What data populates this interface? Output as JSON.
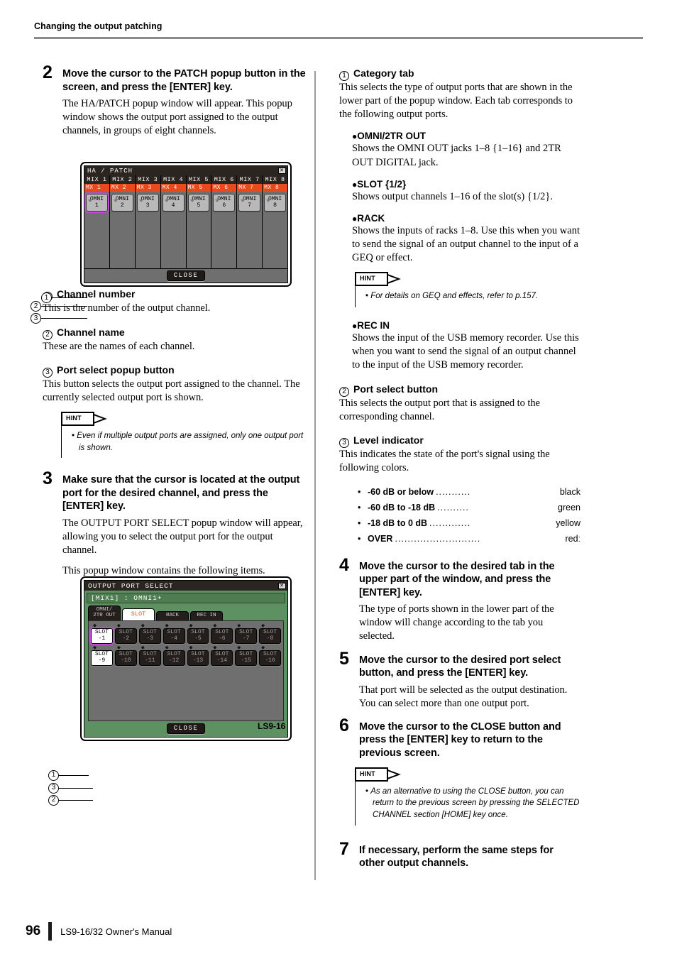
{
  "header": {
    "title": "Changing the output patching"
  },
  "footer": {
    "page_number": "96",
    "manual": "LS9-16/32  Owner's Manual"
  },
  "left": {
    "step2": {
      "num": "2",
      "head": "Move the cursor to the PATCH popup button in the screen, and press the [ENTER] key.",
      "body": "The HA/PATCH popup window will appear. This popup window shows the output port assigned to the output channels, in groups of eight channels."
    },
    "ha_patch": {
      "title": "HA / PATCH",
      "close_icon": "close-icon",
      "close_label": "CLOSE",
      "channel_numbers": [
        "MIX 1",
        "MIX 2",
        "MIX 3",
        "MIX 4",
        "MIX 5",
        "MIX 6",
        "MIX 7",
        "MIX 8"
      ],
      "channel_names": [
        "MX  1",
        "MX  2",
        "MX  3",
        "MX  4",
        "MX  5",
        "MX  6",
        "MX  7",
        "MX  8"
      ],
      "port_buttons": [
        "OMNI\n1",
        "OMNI\n2",
        "OMNI\n3",
        "OMNI\n4",
        "OMNI\n5",
        "OMNI\n6",
        "OMNI\n7",
        "OMNI\n8"
      ],
      "port_top": "OMNI",
      "port_nums": [
        "1",
        "2",
        "3",
        "4",
        "5",
        "6",
        "7",
        "8"
      ],
      "selected_index": 0,
      "callouts": [
        "1",
        "2",
        "3"
      ],
      "accent_name_row": "#e8491d",
      "cursor_color": "#c14bd6"
    },
    "items": [
      {
        "num": "1",
        "head": "Channel number",
        "body": "This is the number of the output channel."
      },
      {
        "num": "2",
        "head": "Channel name",
        "body": "These are the names of each channel."
      },
      {
        "num": "3",
        "head": "Port select popup button",
        "body": "This button selects the output port assigned to the channel. The currently selected output port is shown."
      }
    ],
    "hint1": {
      "tag": "HINT",
      "text": "Even if multiple output ports are assigned, only one output port is shown."
    },
    "step3": {
      "num": "3",
      "head": "Make sure that the cursor is located at the output port for the desired channel, and press the [ENTER] key.",
      "body": "The OUTPUT PORT SELECT popup window will appear, allowing you to select the output port for the output channel.",
      "body2": "This popup window contains the following items."
    },
    "ops": {
      "title": "OUTPUT PORT SELECT",
      "close_icon": "close-icon",
      "subtitle": "[MIX1] : OMNI1+",
      "tabs": [
        {
          "label": "OMNI/\n2TR OUT",
          "line1": "OMNI/",
          "line2": "2TR OUT",
          "active": false
        },
        {
          "label": "SLOT",
          "line1": "SLOT",
          "line2": "",
          "active": true
        },
        {
          "label": "RACK",
          "line1": "RACK",
          "line2": "",
          "active": false
        },
        {
          "label": "REC IN",
          "line1": "REC IN",
          "line2": "",
          "active": false
        }
      ],
      "row1": [
        "SLOT\n-1",
        "SLOT\n-2",
        "SLOT\n-3",
        "SLOT\n-4",
        "SLOT\n-5",
        "SLOT\n-6",
        "SLOT\n-7",
        "SLOT\n-8"
      ],
      "row1_top": [
        "SLOT",
        "SLOT",
        "SLOT",
        "SLOT",
        "SLOT",
        "SLOT",
        "SLOT",
        "SLOT"
      ],
      "row1_bot": [
        "-1",
        "-2",
        "-3",
        "-4",
        "-5",
        "-6",
        "-7",
        "-8"
      ],
      "row2_top": [
        "SLOT",
        "SLOT",
        "SLOT",
        "SLOT",
        "SLOT",
        "SLOT",
        "SLOT",
        "SLOT"
      ],
      "row2_bot": [
        "-9",
        "-10",
        "-11",
        "-12",
        "-13",
        "-14",
        "-15",
        "-16"
      ],
      "selected": [
        "-1",
        "-9"
      ],
      "cursor_on": "-1",
      "close_label": "CLOSE",
      "callouts": [
        "1",
        "3",
        "2"
      ],
      "caption": "LS9-16"
    }
  },
  "right": {
    "item1": {
      "num": "1",
      "head": "Category tab",
      "body": "This selects the type of output ports that are shown in the lower part of the popup window. Each tab corresponds to the following output ports."
    },
    "subs": [
      {
        "head": "OMNI/2TR OUT",
        "body": "Shows the OMNI OUT jacks 1–8 {1–16} and 2TR OUT DIGITAL jack."
      },
      {
        "head": "SLOT {1/2}",
        "body": "Shows output channels 1–16 of the slot(s) {1/2}."
      },
      {
        "head": "RACK",
        "body": "Shows the inputs of racks 1–8. Use this when you want to send the signal of an output channel to the input of a GEQ or effect."
      }
    ],
    "hint2": {
      "tag": "HINT",
      "text": "For details on GEQ and effects, refer to p.157."
    },
    "sub_recin": {
      "head": "REC IN",
      "body": "Shows the input of the USB memory recorder. Use this when you want to send the signal of an output channel to the input of the USB memory recorder."
    },
    "item2": {
      "num": "2",
      "head": "Port select button",
      "body": "This selects the output port that is assigned to the corresponding channel."
    },
    "item3": {
      "num": "3",
      "head": "Level indicator",
      "body": "This indicates the state of the port's signal using the following colors."
    },
    "levels": [
      {
        "key": "-60 dB or below",
        "dots": "...........",
        "value": "black"
      },
      {
        "key": "-60 dB to -18 dB",
        "dots": "..........",
        "value": "green"
      },
      {
        "key": "-18 dB to 0 dB",
        "dots": ".............",
        "value": "yellow"
      },
      {
        "key": "OVER",
        "dots": "...........................",
        "value": "redː"
      }
    ],
    "step4": {
      "num": "4",
      "head": "Move the cursor to the desired tab in the upper part of the window, and press the [ENTER] key.",
      "body": "The type of ports shown in the lower part of the window will change according to the tab you selected."
    },
    "step5": {
      "num": "5",
      "head": "Move the cursor to the desired port select button, and press the [ENTER] key.",
      "body": "That port will be selected as the output destination. You can select more than one output port."
    },
    "step6": {
      "num": "6",
      "head": "Move the cursor to the CLOSE button and press the [ENTER] key to return to the previous screen."
    },
    "hint3": {
      "tag": "HINT",
      "text": "As an alternative to using the CLOSE button, you can return to the previous screen by pressing the SELECTED CHANNEL section [HOME] key once."
    },
    "step7": {
      "num": "7",
      "head": "If necessary, perform the same steps for other output channels."
    }
  }
}
